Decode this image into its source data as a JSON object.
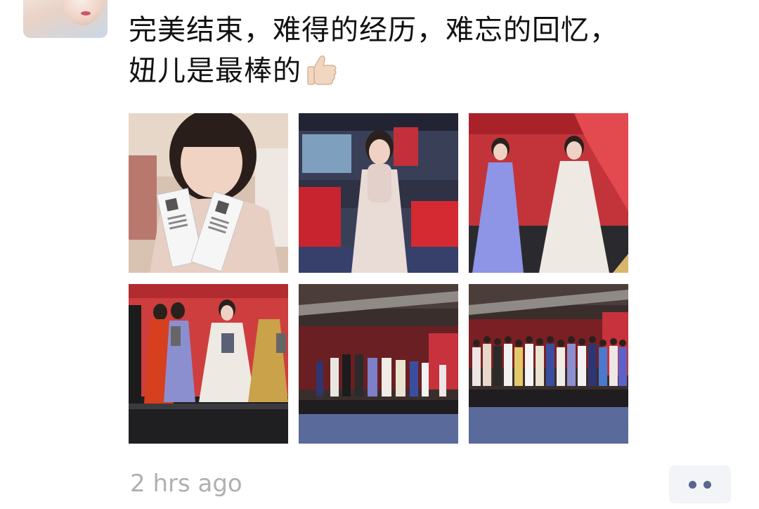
{
  "post": {
    "text_line1": "完美结束，难得的经历，难忘的回忆，",
    "text_line2": "妞儿是最棒的",
    "emoji": "thumbs-up-icon",
    "timestamp": "2 hrs ago"
  },
  "photos": [
    {
      "name": "girl-holding-tickets-photo"
    },
    {
      "name": "girl-white-dress-banquet-photo"
    },
    {
      "name": "two-girls-on-stage-photo"
    },
    {
      "name": "award-ceremony-photo"
    },
    {
      "name": "stage-group-line-photo"
    },
    {
      "name": "full-cast-group-photo"
    }
  ],
  "more_button": {
    "icon": "more-dots-icon"
  },
  "colors": {
    "timestamp": "#b0b0b0",
    "more_dots": "#59678e",
    "more_bg": "#f3f4f7"
  }
}
